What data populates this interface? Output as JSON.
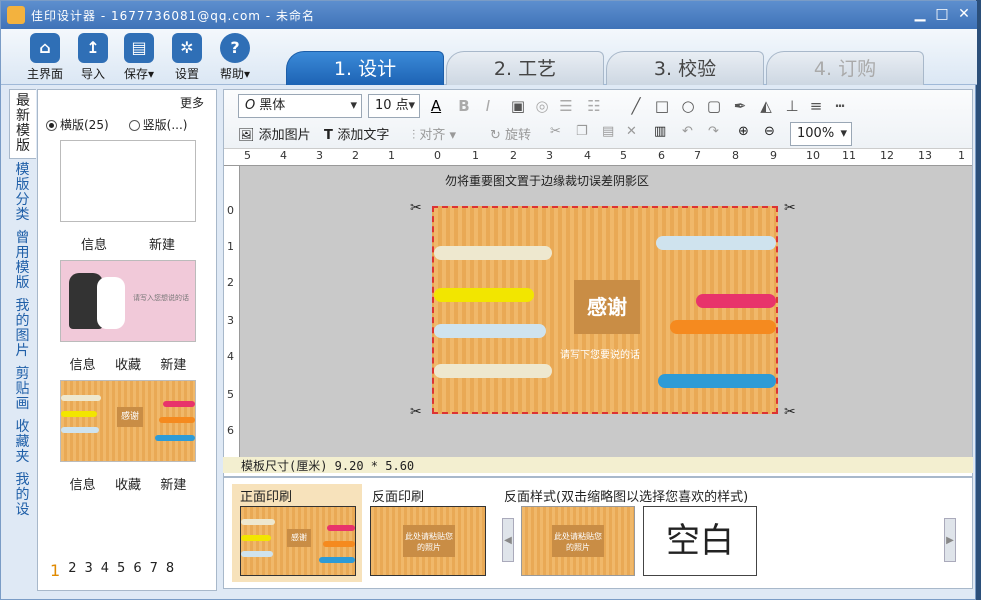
{
  "window": {
    "title": "佳印设计器 - 1677736081@qq.com - 未命名"
  },
  "toolbar": [
    {
      "label": "主界面",
      "icon": "home-icon"
    },
    {
      "label": "导入",
      "icon": "import-icon"
    },
    {
      "label": "保存",
      "icon": "save-icon"
    },
    {
      "label": "设置",
      "icon": "gear-icon"
    },
    {
      "label": "帮助",
      "icon": "help-icon"
    }
  ],
  "tabs": [
    {
      "label": "1. 设计",
      "state": "active"
    },
    {
      "label": "2. 工艺",
      "state": "normal"
    },
    {
      "label": "3. 校验",
      "state": "normal"
    },
    {
      "label": "4. 订购",
      "state": "disabled"
    }
  ],
  "sidebar": {
    "tabs": [
      "最新模版",
      "模版分类",
      "曾用模版",
      "我的图片",
      "剪贴画",
      "收藏夹",
      "我的设"
    ]
  },
  "templates": {
    "more": "更多",
    "orient_h": "横版(25)",
    "orient_v": "竖版(...)",
    "items": [
      {
        "actions": [
          "信息",
          "新建"
        ],
        "text": ""
      },
      {
        "actions": [
          "信息",
          "收藏",
          "新建"
        ],
        "text": "请写入您想说的话"
      },
      {
        "actions": [
          "信息",
          "收藏",
          "新建"
        ],
        "text": "感谢"
      }
    ],
    "pages": [
      "1",
      "2",
      "3",
      "4",
      "5",
      "6",
      "7",
      "8"
    ],
    "current_page": "1"
  },
  "format": {
    "font": "黑体",
    "size": "10 点",
    "add_image": "添加图片",
    "add_text": "添加文字",
    "align": "对齐",
    "rotate": "旋转",
    "zoom": "100%"
  },
  "ruler": {
    "labels": [
      "5",
      "4",
      "3",
      "2",
      "1",
      "0",
      "1",
      "2",
      "3",
      "4",
      "5",
      "6",
      "7",
      "8",
      "9",
      "10",
      "11",
      "12",
      "13",
      "1"
    ]
  },
  "vruler": {
    "labels": [
      "0",
      "1",
      "2",
      "3",
      "4",
      "5",
      "6"
    ]
  },
  "canvas": {
    "warning": "勿将重要图文置于边缘裁切误差阴影区",
    "card_title": "感谢",
    "card_subtitle": "请写下您要说的话"
  },
  "status": {
    "size_text": "模板尺寸(厘米) 9.20 * 5.60"
  },
  "bottom": {
    "front": "正面印刷",
    "back": "反面印刷",
    "back_style": "反面样式(双击缩略图以选择您喜欢的样式)",
    "back_thumb_text": "此处请粘贴您的照片",
    "blank": "空白"
  },
  "colors": {
    "accent": "#1d63b4",
    "card": "#f0b86a",
    "crop_line": "#dd3333"
  }
}
